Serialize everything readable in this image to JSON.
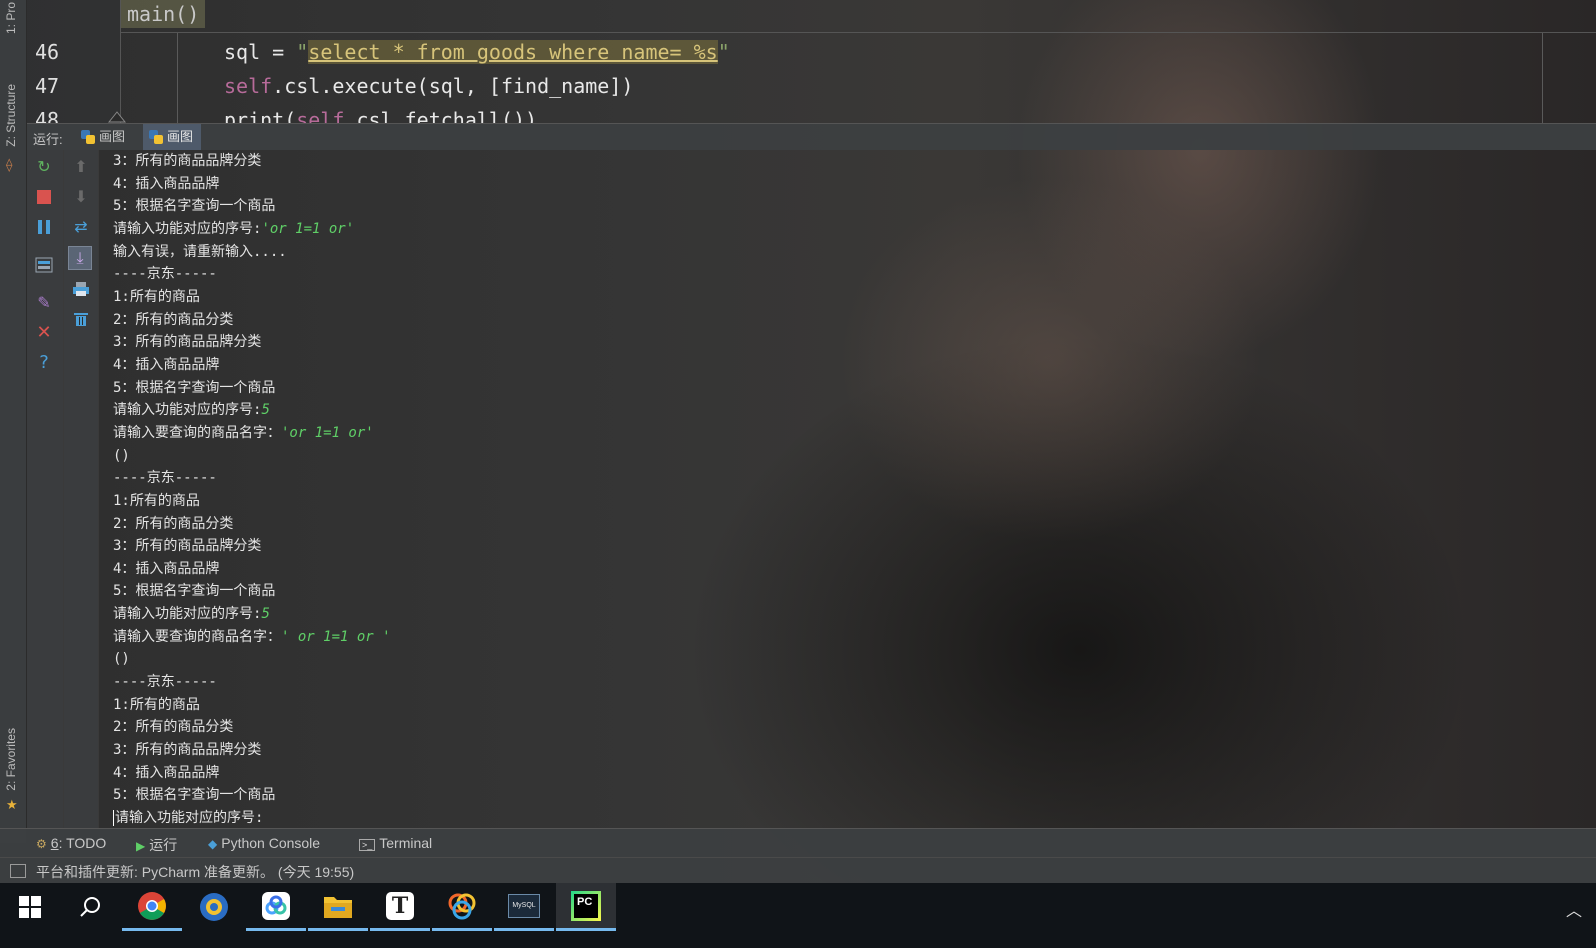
{
  "editor": {
    "breadcrumb": "main()",
    "lines": [
      {
        "number": "46",
        "prefix": "sql = ",
        "q1": "\"",
        "sql": "select * from goods where name= %s",
        "q2": "\""
      },
      {
        "number": "47",
        "self": "self",
        "rest": ".csl.execute(sql, [find_name])"
      },
      {
        "number": "48",
        "prefix": "print(",
        "self": "self",
        "rest": ".csl.fetchall())"
      }
    ]
  },
  "left_stripe": {
    "project_label": "1: Pro",
    "structure_label": "Z: Structure",
    "favorites_label": "2: Favorites"
  },
  "run_panel": {
    "label": "运行:",
    "tabs": [
      {
        "label": "画图",
        "active": false
      },
      {
        "label": "画图",
        "active": true
      }
    ]
  },
  "console": {
    "lines": [
      {
        "text": "3：所有的商品品牌分类",
        "input": ""
      },
      {
        "text": "4：插入商品品牌",
        "input": ""
      },
      {
        "text": "5：根据名字查询一个商品",
        "input": ""
      },
      {
        "text": "请输入功能对应的序号:",
        "input": "'or 1=1 or'"
      },
      {
        "text": "输入有误，请重新输入....",
        "input": ""
      },
      {
        "text": "----京东-----",
        "input": ""
      },
      {
        "text": "1:所有的商品",
        "input": ""
      },
      {
        "text": "2：所有的商品分类",
        "input": ""
      },
      {
        "text": "3：所有的商品品牌分类",
        "input": ""
      },
      {
        "text": "4：插入商品品牌",
        "input": ""
      },
      {
        "text": "5：根据名字查询一个商品",
        "input": ""
      },
      {
        "text": "请输入功能对应的序号:",
        "input": "5"
      },
      {
        "text": "请输入要查询的商品名字：",
        "input": "'or 1=1 or'"
      },
      {
        "text": "()",
        "input": ""
      },
      {
        "text": "----京东-----",
        "input": ""
      },
      {
        "text": "1:所有的商品",
        "input": ""
      },
      {
        "text": "2：所有的商品分类",
        "input": ""
      },
      {
        "text": "3：所有的商品品牌分类",
        "input": ""
      },
      {
        "text": "4：插入商品品牌",
        "input": ""
      },
      {
        "text": "5：根据名字查询一个商品",
        "input": ""
      },
      {
        "text": "请输入功能对应的序号:",
        "input": "5"
      },
      {
        "text": "请输入要查询的商品名字：",
        "input": "' or 1=1 or '"
      },
      {
        "text": "()",
        "input": ""
      },
      {
        "text": "----京东-----",
        "input": ""
      },
      {
        "text": "1:所有的商品",
        "input": ""
      },
      {
        "text": "2：所有的商品分类",
        "input": ""
      },
      {
        "text": "3：所有的商品品牌分类",
        "input": ""
      },
      {
        "text": "4：插入商品品牌",
        "input": ""
      },
      {
        "text": "5：根据名字查询一个商品",
        "input": ""
      },
      {
        "text": "请输入功能对应的序号:",
        "input": ""
      }
    ]
  },
  "bottom_tabs": {
    "todo_number": "6",
    "todo": ": TODO",
    "run": "运行",
    "python_console": "Python Console",
    "terminal": "Terminal"
  },
  "status": {
    "text": "平台和插件更新: PyCharm 准备更新。 (今天 19:55)"
  },
  "taskbar": {
    "apps": [
      "start",
      "search",
      "chrome",
      "app-globe",
      "baidu-netdisk",
      "file-explorer",
      "typora",
      "color-app",
      "mysql",
      "pycharm"
    ],
    "pycharm_label": "PC",
    "mysql_label": "MySQL",
    "typora_label": "T"
  },
  "colors": {
    "console_input": "#5fcf67",
    "self_keyword": "#b76b9a",
    "sql_highlight": "#d7c47a",
    "active_tab": "#4e5a6a"
  }
}
